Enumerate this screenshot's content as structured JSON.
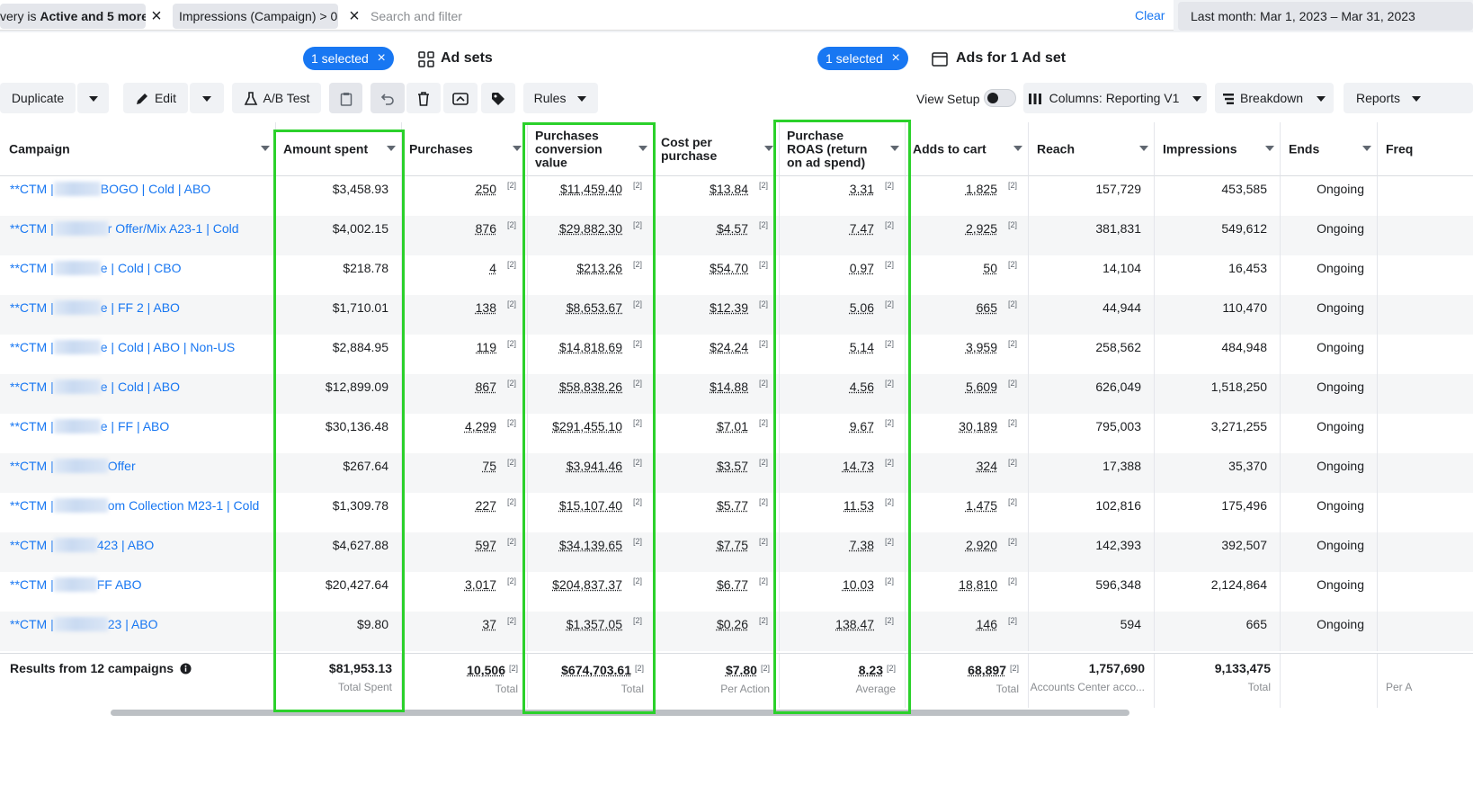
{
  "filter_bar": {
    "chip1_text": "very is Active and 5 more",
    "chip1_bold": "Active and 5 more",
    "chip1_prefix": "very is ",
    "chip2_text": "Impressions (Campaign) > 0",
    "search_placeholder": "Search and filter",
    "clear_label": "Clear",
    "date_range": "Last month: Mar 1, 2023 – Mar 31, 2023"
  },
  "tabs": {
    "campaigns_selected": "1 selected",
    "adsets_title": "Ad sets",
    "adsets_selected": "1 selected",
    "ads_title": "Ads for 1 Ad set"
  },
  "toolbar": {
    "duplicate": "Duplicate",
    "edit": "Edit",
    "ab_test": "A/B Test",
    "rules": "Rules",
    "view_setup": "View Setup",
    "columns": "Columns: Reporting V1",
    "breakdown": "Breakdown",
    "reports": "Reports"
  },
  "table": {
    "headers": {
      "campaign": "Campaign",
      "amount_spent": "Amount spent",
      "purchases": "Purchases",
      "purchases_conversion_value": "Purchases conversion value",
      "cost_per_purchase": "Cost per purchase",
      "purchase_roas": "Purchase ROAS (return on ad spend)",
      "adds_to_cart": "Adds to cart",
      "reach": "Reach",
      "impressions": "Impressions",
      "ends": "Ends",
      "frequency": "Freq"
    },
    "footnote_marker": "[2]",
    "rows": [
      {
        "prefix": "**CTM |",
        "name": "BOGO | Cold | ABO",
        "spent": "$3,458.93",
        "purchases": "250",
        "conv_value": "$11,459.40",
        "cost_per": "$13.84",
        "roas": "3.31",
        "atc": "1,825",
        "reach": "157,729",
        "impressions": "453,585",
        "ends": "Ongoing"
      },
      {
        "prefix": "**CTM |",
        "name": "r Offer/Mix A23-1 | Cold",
        "spent": "$4,002.15",
        "purchases": "876",
        "conv_value": "$29,882.30",
        "cost_per": "$4.57",
        "roas": "7.47",
        "atc": "2,925",
        "reach": "381,831",
        "impressions": "549,612",
        "ends": "Ongoing"
      },
      {
        "prefix": "**CTM |",
        "name": "e | Cold | CBO",
        "spent": "$218.78",
        "purchases": "4",
        "conv_value": "$213.26",
        "cost_per": "$54.70",
        "roas": "0.97",
        "atc": "50",
        "reach": "14,104",
        "impressions": "16,453",
        "ends": "Ongoing"
      },
      {
        "prefix": "**CTM |",
        "name": "e | FF 2 | ABO",
        "spent": "$1,710.01",
        "purchases": "138",
        "conv_value": "$8,653.67",
        "cost_per": "$12.39",
        "roas": "5.06",
        "atc": "665",
        "reach": "44,944",
        "impressions": "110,470",
        "ends": "Ongoing"
      },
      {
        "prefix": "**CTM |",
        "name": "e | Cold | ABO | Non-US",
        "spent": "$2,884.95",
        "purchases": "119",
        "conv_value": "$14,818.69",
        "cost_per": "$24.24",
        "roas": "5.14",
        "atc": "3,959",
        "reach": "258,562",
        "impressions": "484,948",
        "ends": "Ongoing"
      },
      {
        "prefix": "**CTM |",
        "name": "e | Cold | ABO",
        "spent": "$12,899.09",
        "purchases": "867",
        "conv_value": "$58,838.26",
        "cost_per": "$14.88",
        "roas": "4.56",
        "atc": "5,609",
        "reach": "626,049",
        "impressions": "1,518,250",
        "ends": "Ongoing"
      },
      {
        "prefix": "**CTM |",
        "name": "e | FF | ABO",
        "spent": "$30,136.48",
        "purchases": "4,299",
        "conv_value": "$291,455.10",
        "cost_per": "$7.01",
        "roas": "9.67",
        "atc": "30,189",
        "reach": "795,003",
        "impressions": "3,271,255",
        "ends": "Ongoing"
      },
      {
        "prefix": "**CTM |",
        "name": "Offer",
        "spent": "$267.64",
        "purchases": "75",
        "conv_value": "$3,941.46",
        "cost_per": "$3.57",
        "roas": "14.73",
        "atc": "324",
        "reach": "17,388",
        "impressions": "35,370",
        "ends": "Ongoing"
      },
      {
        "prefix": "**CTM |",
        "name": "om Collection M23-1 | Cold",
        "spent": "$1,309.78",
        "purchases": "227",
        "conv_value": "$15,107.40",
        "cost_per": "$5.77",
        "roas": "11.53",
        "atc": "1,475",
        "reach": "102,816",
        "impressions": "175,496",
        "ends": "Ongoing"
      },
      {
        "prefix": "**CTM |",
        "name": "423 | ABO",
        "spent": "$4,627.88",
        "purchases": "597",
        "conv_value": "$34,139.65",
        "cost_per": "$7.75",
        "roas": "7.38",
        "atc": "2,920",
        "reach": "142,393",
        "impressions": "392,507",
        "ends": "Ongoing"
      },
      {
        "prefix": "**CTM |",
        "name": "FF ABO",
        "spent": "$20,427.64",
        "purchases": "3,017",
        "conv_value": "$204,837.37",
        "cost_per": "$6.77",
        "roas": "10.03",
        "atc": "18,810",
        "reach": "596,348",
        "impressions": "2,124,864",
        "ends": "Ongoing"
      },
      {
        "prefix": "**CTM |",
        "name": "23 | ABO",
        "spent": "$9.80",
        "purchases": "37",
        "conv_value": "$1,357.05",
        "cost_per": "$0.26",
        "roas": "138.47",
        "atc": "146",
        "reach": "594",
        "impressions": "665",
        "ends": "Ongoing"
      }
    ],
    "totals": {
      "label": "Results from 12 campaigns",
      "spent": "$81,953.13",
      "spent_sub": "Total Spent",
      "purchases": "10,506",
      "purchases_sub": "Total",
      "conv_value": "$674,703.61",
      "conv_value_sub": "Total",
      "cost_per": "$7.80",
      "cost_per_sub": "Per Action",
      "roas": "8.23",
      "roas_sub": "Average",
      "atc": "68,897",
      "atc_sub": "Total",
      "reach": "1,757,690",
      "reach_sub": "Accounts Center acco...",
      "impressions": "9,133,475",
      "impressions_sub": "Total",
      "freq_sub": "Per A"
    }
  },
  "colors": {
    "link": "#1877f2",
    "highlight": "#2bd12b",
    "pill": "#1877f2"
  }
}
